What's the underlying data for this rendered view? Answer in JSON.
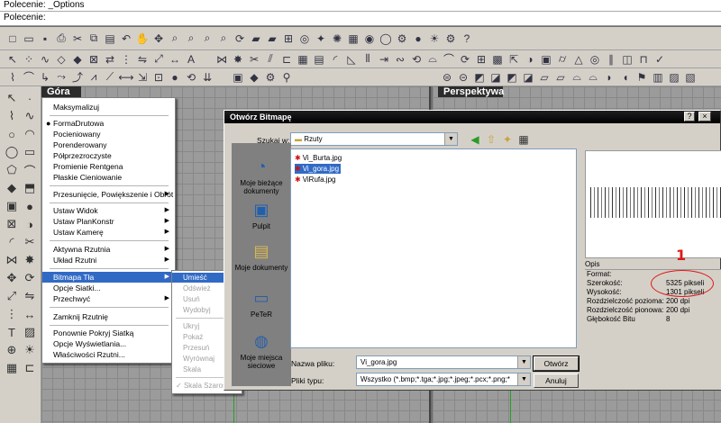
{
  "command": {
    "line1": "Polecenie: _Options",
    "line2": "Polecenie:"
  },
  "viewports": {
    "left_title": "Góra",
    "right_title": "Perspektywa"
  },
  "context_menu": {
    "items": [
      {
        "label": "Maksymalizuj",
        "arrow": false,
        "bullet": false
      },
      {
        "label": "FormaDrutowa",
        "arrow": false,
        "bullet": true
      },
      {
        "label": "Pocieniowany",
        "arrow": false,
        "bullet": false
      },
      {
        "label": "Porenderowany",
        "arrow": false,
        "bullet": false
      },
      {
        "label": "Półprzezroczyste",
        "arrow": false,
        "bullet": false
      },
      {
        "label": "Promienie Rentgena",
        "arrow": false,
        "bullet": false
      },
      {
        "label": "Płaskie Cieniowanie",
        "arrow": false,
        "bullet": false
      },
      {
        "label": "Przesunięcie, Powiększenie i Obrót",
        "arrow": true,
        "bullet": false
      },
      {
        "label": "Ustaw Widok",
        "arrow": true,
        "bullet": false
      },
      {
        "label": "Ustaw PlanKonstr",
        "arrow": true,
        "bullet": false
      },
      {
        "label": "Ustaw Kamerę",
        "arrow": true,
        "bullet": false
      },
      {
        "label": "Aktywna Rzutnia",
        "arrow": true,
        "bullet": false
      },
      {
        "label": "Układ Rzutni",
        "arrow": true,
        "bullet": false
      },
      {
        "label": "Bitmapa Tła",
        "arrow": true,
        "bullet": false
      },
      {
        "label": "Opcje Siatki...",
        "arrow": false,
        "bullet": false
      },
      {
        "label": "Przechwyć",
        "arrow": true,
        "bullet": false
      },
      {
        "label": "Zamknij Rzutnię",
        "arrow": false,
        "bullet": false
      },
      {
        "label": "Ponownie Pokryj Siatką",
        "arrow": false,
        "bullet": false
      },
      {
        "label": "Opcje Wyświetlania...",
        "arrow": false,
        "bullet": false
      },
      {
        "label": "Właściwości Rzutni...",
        "arrow": false,
        "bullet": false
      }
    ]
  },
  "sub_menu": {
    "items": [
      "Umieść",
      "Odśwież",
      "Usuń",
      "Wydobyj",
      "Ukryj",
      "Pokaż",
      "Przesuń",
      "Wyrównaj",
      "Skala",
      "Skala Szarości"
    ]
  },
  "dialog": {
    "title": "Otwórz Bitmapę",
    "help": "?",
    "close": "×",
    "look_in_label": "Szukaj w:",
    "look_in_value": "Rzuty",
    "places": [
      "Moje bieżące dokumenty",
      "Pulpit",
      "Moje dokumenty",
      "PeTeR",
      "Moje miejsca sieciowe"
    ],
    "files": [
      "Vi_Burta.jpg",
      "Vi_gora.jpg",
      "ViRufa.jpg"
    ],
    "filename_label": "Nazwa pliku:",
    "filename_value": "Vi_gora.jpg",
    "filetype_label": "Pliki typu:",
    "filetype_value": "Wszystko (*.bmp;*.tga;*.jpg;*.jpeg;*.pcx;*.png;*",
    "open_button": "Otwórz",
    "cancel_button": "Anuluj",
    "opis_label": "Opis",
    "info": [
      {
        "k": "Format:",
        "v": ""
      },
      {
        "k": "Szerokość:",
        "v": "5325 pikseli"
      },
      {
        "k": "Wysokość:",
        "v": "1301 pikseli"
      },
      {
        "k": "Rozdzielczość pozioma:",
        "v": "200 dpi"
      },
      {
        "k": "Rozdzielczość pionowa:",
        "v": "200 dpi"
      },
      {
        "k": "Głębokość Bitu",
        "v": "8"
      }
    ]
  },
  "annotation": {
    "number": "1",
    "color": "#e01818"
  },
  "colors": {
    "highlight": "#316ac5",
    "face": "#d4d0c8",
    "viewport_bg": "#9b9b9b"
  }
}
